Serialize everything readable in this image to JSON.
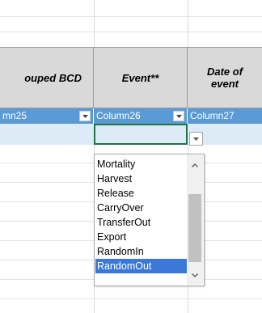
{
  "headers": {
    "col_grouped": "ouped BCD",
    "col_event": "Event**",
    "col_date": "Date of event"
  },
  "filters": {
    "col25": "mn25",
    "col26": "Column26",
    "col27": "Column27"
  },
  "dropdown": {
    "options": [
      "Mortality",
      "Harvest",
      "Release",
      "CarryOver",
      "TransferOut",
      "Export",
      "RandomIn",
      "RandomOut"
    ],
    "selected": "RandomOut"
  },
  "colors": {
    "header_bg": "#d9d9d9",
    "filter_bg": "#5b9bd5",
    "row_bg": "#ddebf7",
    "selection_border": "#217346",
    "option_highlight": "#3c78d8"
  }
}
